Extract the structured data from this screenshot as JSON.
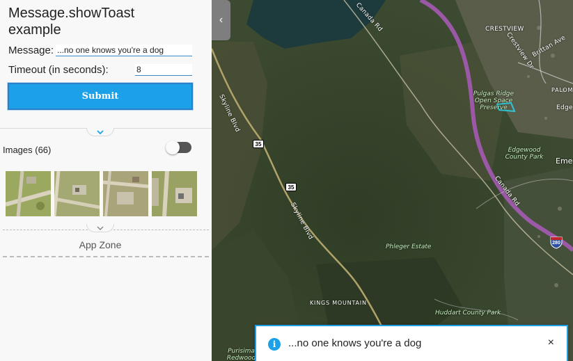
{
  "panel": {
    "title": "Message.showToast example",
    "message_label": "Message:",
    "message_value": "...no one knows you're a dog",
    "timeout_label": "Timeout (in seconds):",
    "timeout_value": "8",
    "submit_label": "Submit",
    "images_label": "Images (66)",
    "images_toggle_on": false,
    "app_zone_label": "App Zone"
  },
  "map": {
    "labels": {
      "canada_rd_top": "Canada Rd",
      "crestview": "CRESTVIEW",
      "crestview_dr": "Crestview Dr",
      "brittan_ave": "Brittan Ave",
      "palomar": "PALOM",
      "edgewood_rd": "Edgew",
      "pulgas_ridge": "Pulgas Ridge Open Space Preserve",
      "edgewood_park": "Edgewood County Park",
      "emerald": "Eme",
      "canada_rd_bottom": "Canada Rd",
      "skyline_top": "Skyline Blvd",
      "skyline_bottom": "Skyline Blvd",
      "phleger": "Phleger Estate",
      "kings_mountain": "KINGS MOUNTAIN",
      "huddart": "Huddart County Park",
      "purisima": "Purisima Redwood"
    },
    "shields": {
      "route_upper": "35",
      "route_lower": "35",
      "interstate": "280"
    }
  },
  "toast": {
    "icon": "i",
    "message": "...no one knows you're a dog",
    "close": "×"
  }
}
